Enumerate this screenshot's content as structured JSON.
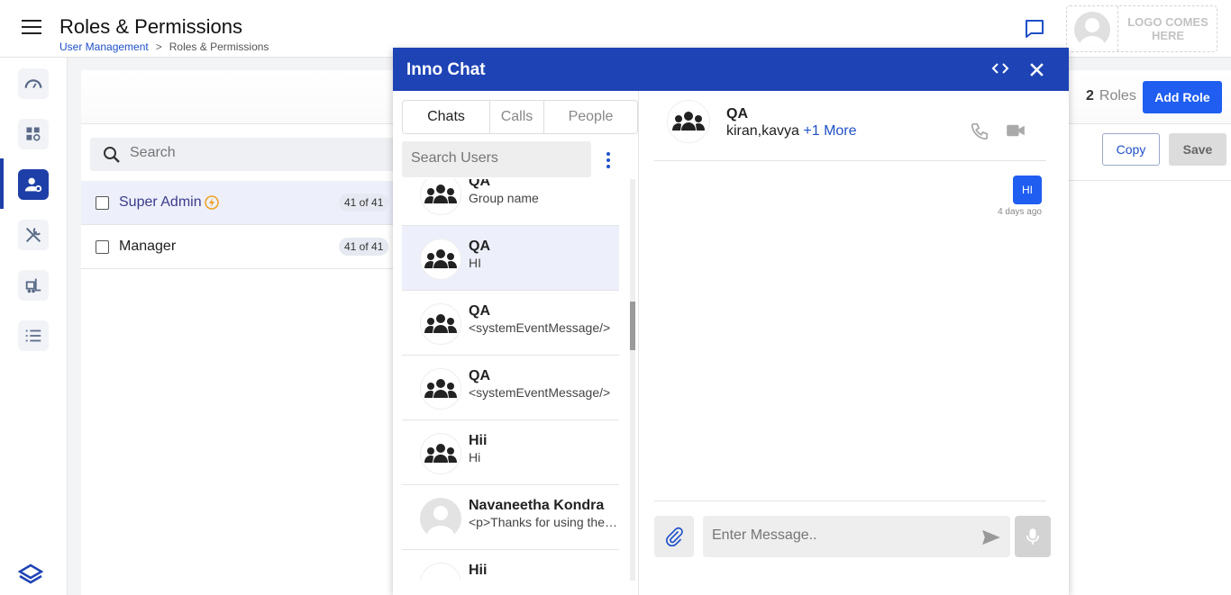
{
  "header": {
    "title": "Roles & Permissions",
    "breadcrumb": {
      "link": "User Management",
      "separator": ">",
      "current": "Roles & Permissions"
    },
    "logo_text": "LOGO COMES HERE"
  },
  "sidebar": {
    "items": [
      {
        "name": "dashboard-gauge-icon"
      },
      {
        "name": "apps-settings-icon"
      },
      {
        "name": "user-settings-icon",
        "active": true
      },
      {
        "name": "tools-icon"
      },
      {
        "name": "forklift-icon"
      },
      {
        "name": "list-icon"
      }
    ],
    "bottom_logo": "app-logo-icon"
  },
  "roles": {
    "count": "2",
    "count_label": "Roles",
    "add_button": "Add Role",
    "search_placeholder": "Search",
    "copy_button": "Copy",
    "save_button": "Save",
    "list": [
      {
        "name": "Super Admin",
        "badge": "41 of 41",
        "selected": true
      },
      {
        "name": "Manager",
        "badge": "41 of 41",
        "selected": false
      }
    ]
  },
  "chat": {
    "title": "Inno Chat",
    "tabs": [
      {
        "label": "Chats",
        "active": true
      },
      {
        "label": "Calls",
        "active": false
      },
      {
        "label": "People",
        "active": false
      }
    ],
    "search_placeholder": "Search Users",
    "items": [
      {
        "name": "QA",
        "message": "Group name",
        "type": "group"
      },
      {
        "name": "QA",
        "message": "HI",
        "type": "group",
        "selected": true
      },
      {
        "name": "QA",
        "message": "<systemEventMessage/>",
        "type": "group"
      },
      {
        "name": "QA",
        "message": "<systemEventMessage/>",
        "type": "group"
      },
      {
        "name": "Hii",
        "message": "Hi",
        "type": "group"
      },
      {
        "name": "Navaneetha Kondra",
        "message": "<p>Thanks for using the …",
        "type": "person"
      },
      {
        "name": "Hii",
        "message": "",
        "type": "group"
      }
    ],
    "conversation": {
      "name": "QA",
      "members": "kiran,kavya",
      "more": "+1 More",
      "messages": [
        {
          "text": "HI",
          "time": "4 days ago"
        }
      ],
      "input_placeholder": "Enter Message.."
    }
  },
  "colors": {
    "brand": "#1d43b5",
    "accent": "#1f5ef0",
    "selected_row": "#edf0fb"
  }
}
